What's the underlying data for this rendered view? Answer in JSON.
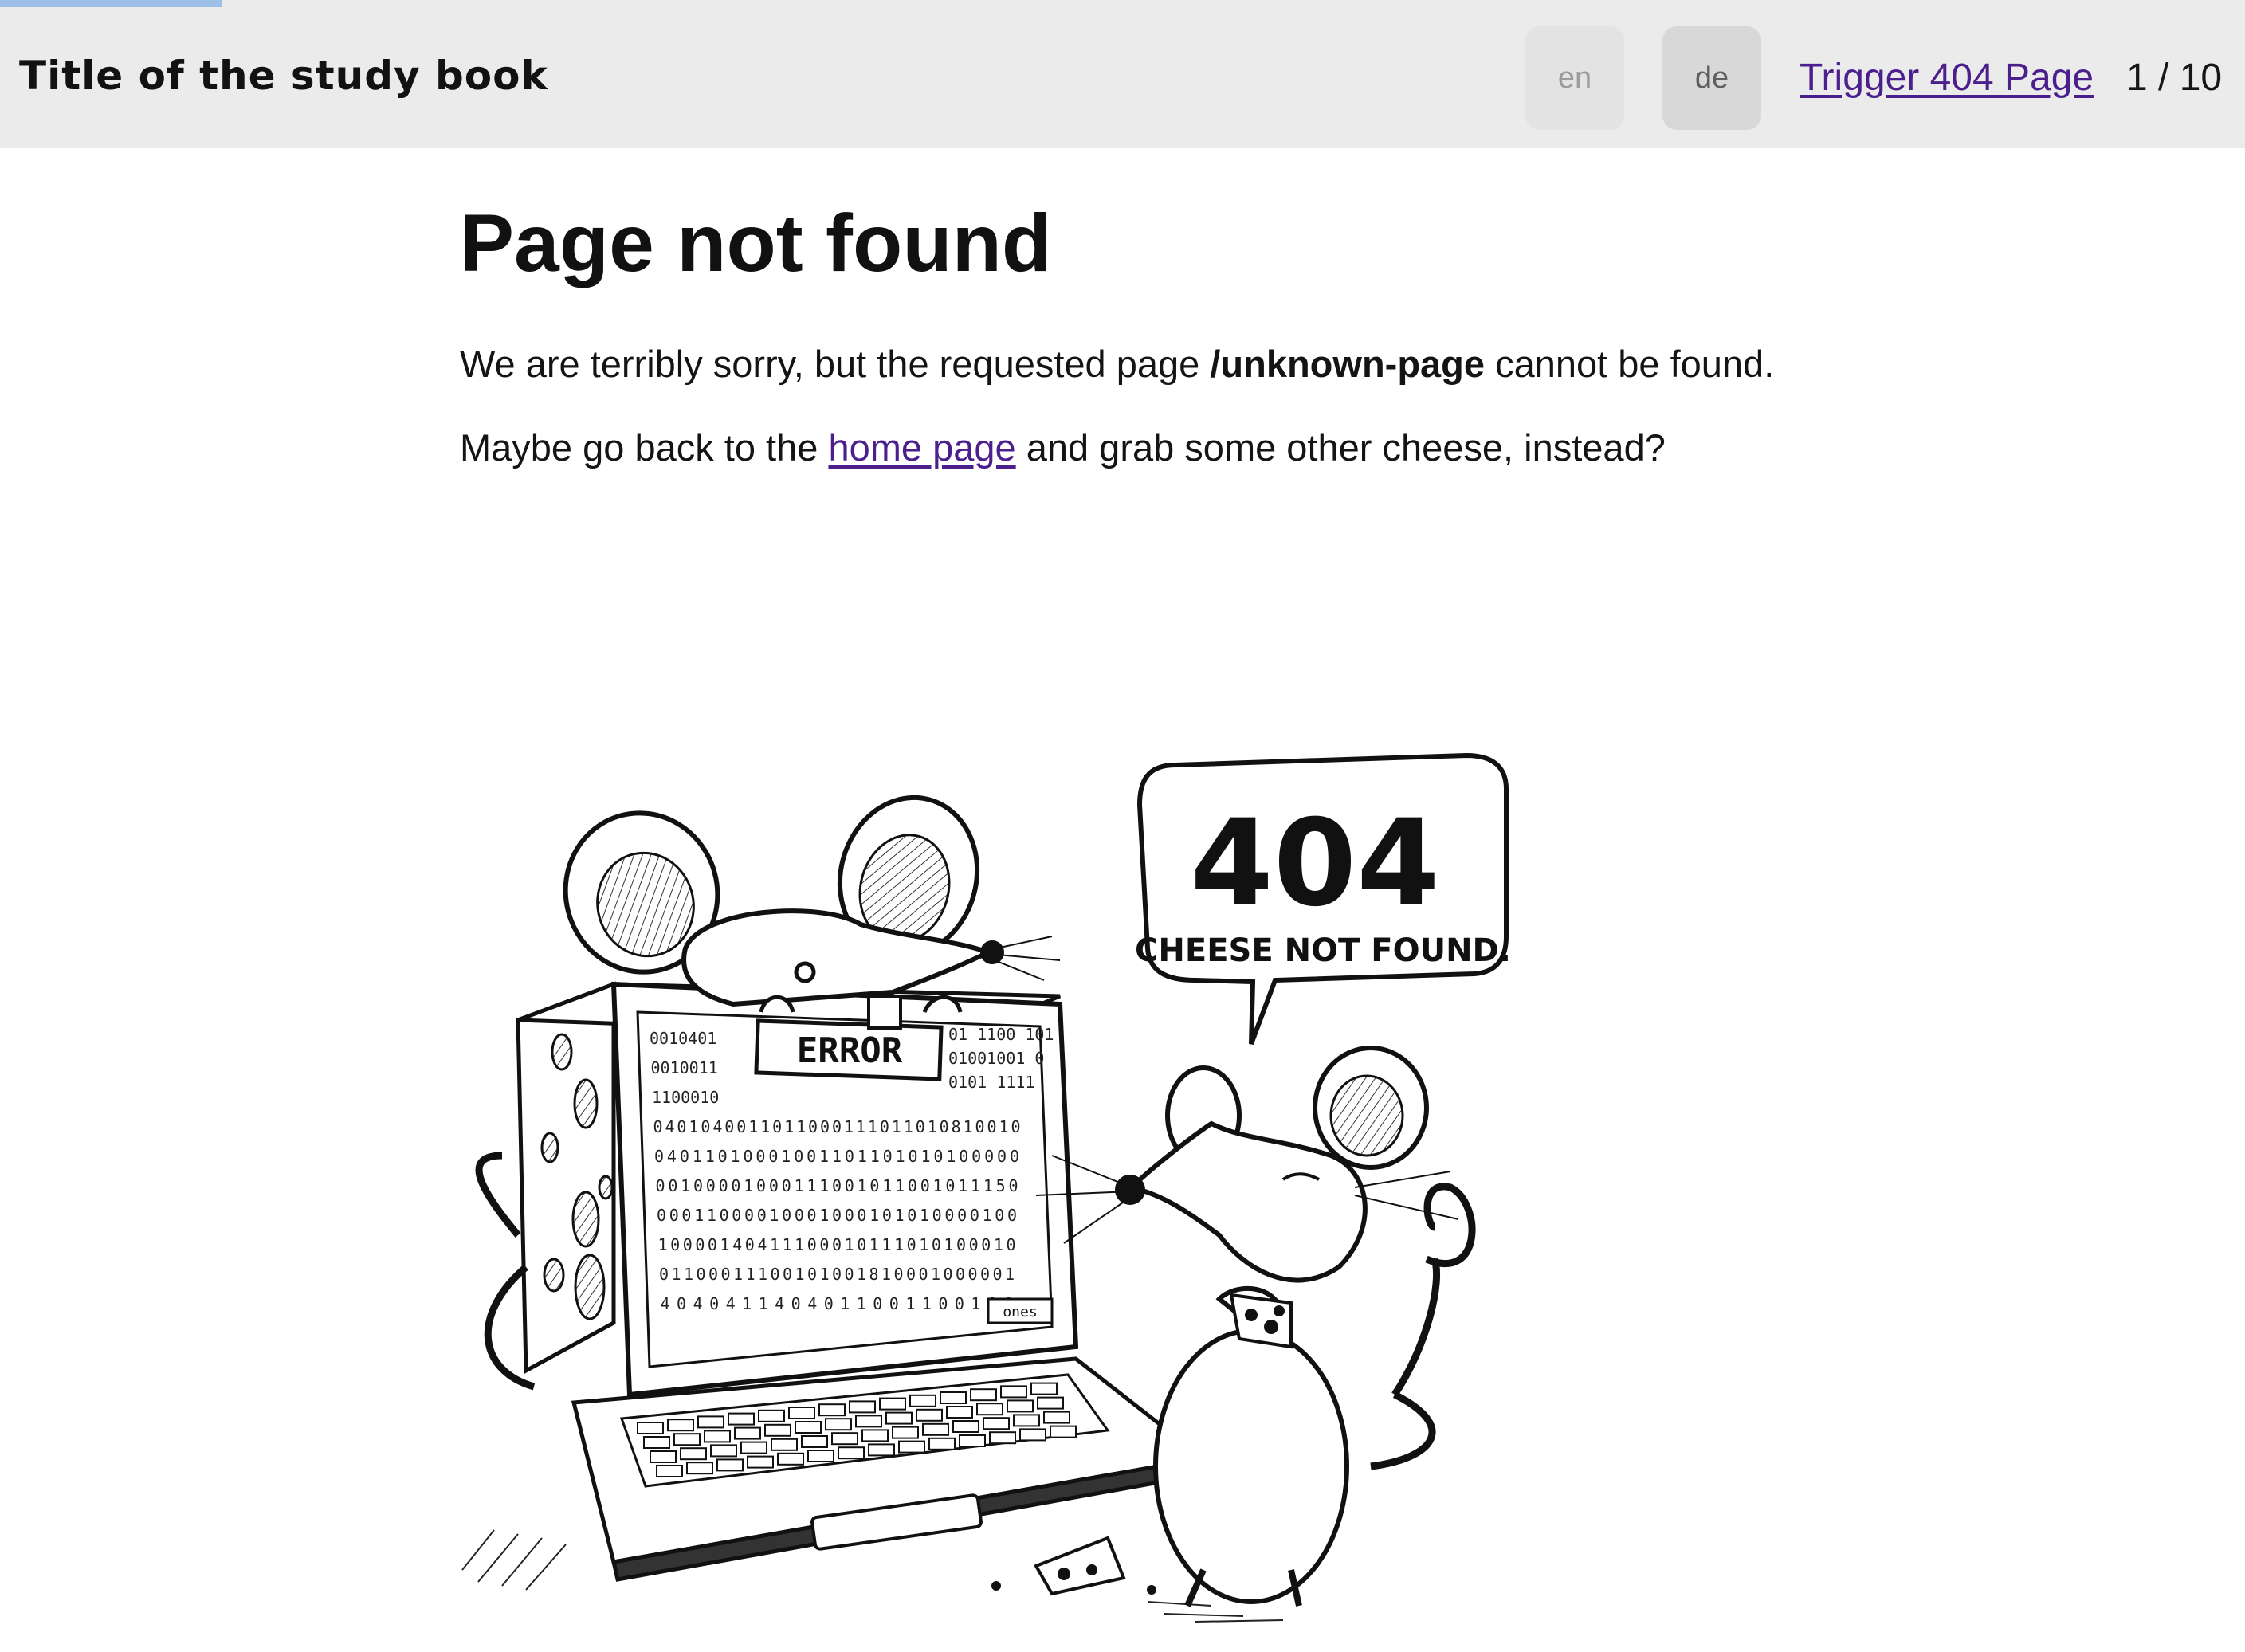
{
  "progress": {
    "fraction": 0.1
  },
  "header": {
    "book_title": "Title of the study book",
    "lang_en": "en",
    "lang_de": "de",
    "trigger_link": "Trigger 404 Page",
    "page_counter": "1 / 10"
  },
  "main": {
    "title": "Page not found",
    "p1_before": "We are terribly sorry, but the requested page ",
    "p1_path": "/unknown-page",
    "p1_after": " cannot be found.",
    "p2_before": "Maybe go back to the ",
    "p2_link": "home page",
    "p2_after": " and grab some other cheese, instead?"
  },
  "illustration": {
    "bubble_number": "404",
    "bubble_text": "CHEESE NOT FOUND.",
    "screen_label": "ERROR",
    "screen_small_label": "ones",
    "binary_rows": [
      "0010401",
      "0010011",
      "1100010",
      "0401040011011000111011010810010",
      "04011010001001101101010100000",
      "00100001000111001011001011150",
      "00011000010001000101010000100",
      "10000140411100010111010100010",
      "01100011100101001810001000001",
      "4040411404011001100100"
    ],
    "binary_right": [
      "01 1100 101",
      "01001001 0",
      "0101 1111"
    ]
  },
  "colors": {
    "header_bg": "#ebebeb",
    "progress": "#9dbfe8",
    "link": "#4b1f8c"
  }
}
